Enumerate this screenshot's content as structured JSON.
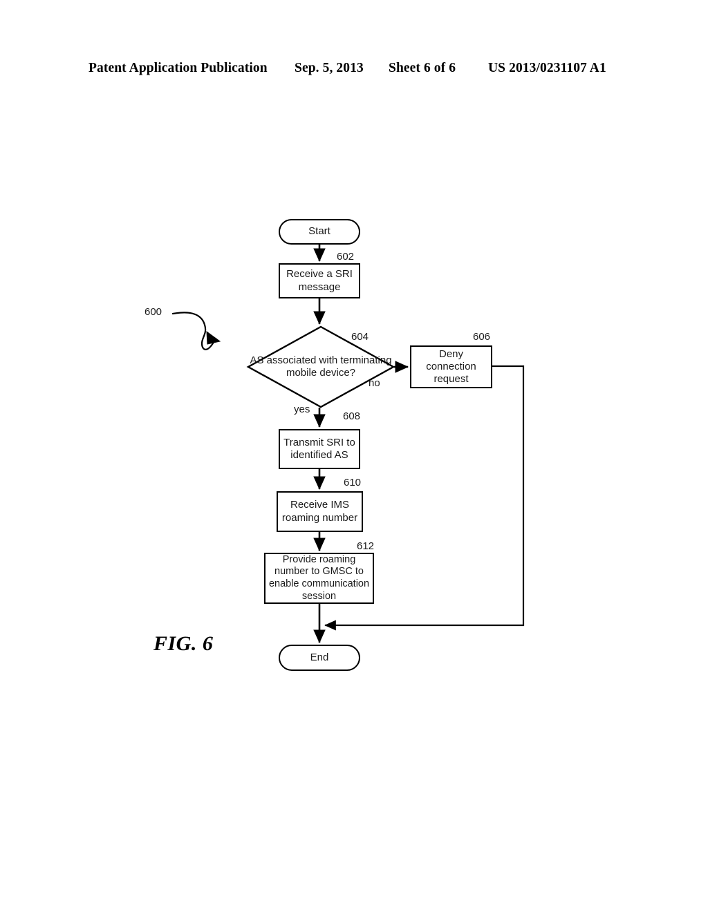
{
  "header": {
    "publication": "Patent Application Publication",
    "date": "Sep. 5, 2013",
    "sheet": "Sheet 6 of 6",
    "patent_number": "US 2013/0231107 A1"
  },
  "figure": {
    "caption": "FIG. 6",
    "diagram_reference": "600"
  },
  "flowchart": {
    "nodes": [
      {
        "id": "start",
        "ref": "",
        "shape": "terminal",
        "text": "Start"
      },
      {
        "id": "602",
        "ref": "602",
        "shape": "process",
        "text": "Receive a SRI message"
      },
      {
        "id": "604",
        "ref": "604",
        "shape": "decision",
        "text": "AS associated with terminating mobile device?"
      },
      {
        "id": "606",
        "ref": "606",
        "shape": "process",
        "text": "Deny connection request"
      },
      {
        "id": "608",
        "ref": "608",
        "shape": "process",
        "text": "Transmit SRI to identified AS"
      },
      {
        "id": "610",
        "ref": "610",
        "shape": "process",
        "text": "Receive IMS roaming number"
      },
      {
        "id": "612",
        "ref": "612",
        "shape": "process",
        "text": "Provide roaming number to GMSC to enable communication session"
      },
      {
        "id": "end",
        "ref": "",
        "shape": "terminal",
        "text": "End"
      }
    ],
    "branch_labels": {
      "yes": "yes",
      "no": "no"
    }
  },
  "colors": {
    "ink": "#000000",
    "text": "#1a1a1a",
    "paper": "#ffffff"
  }
}
